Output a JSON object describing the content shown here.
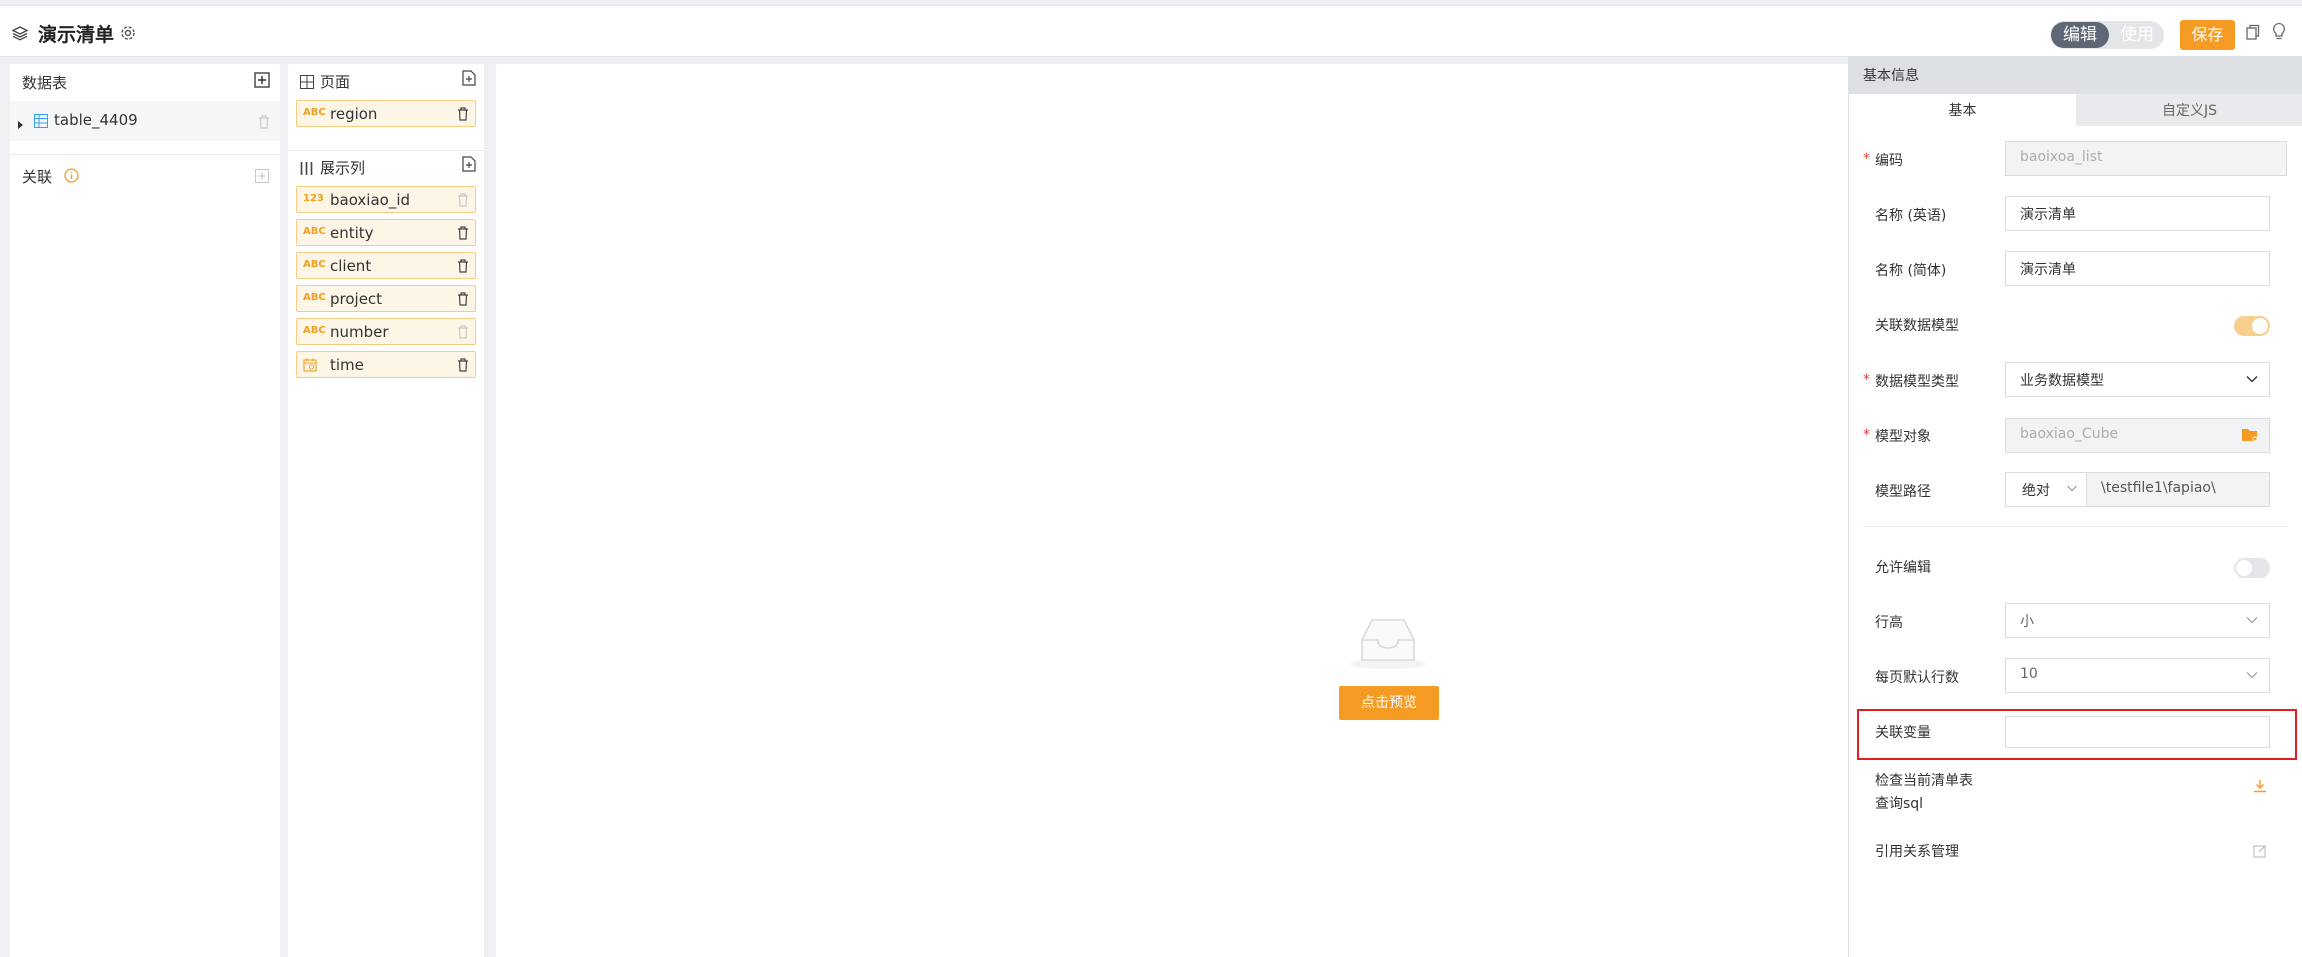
{
  "header": {
    "title": "演示清单",
    "mode_edit": "编辑",
    "mode_use": "使用",
    "save_label": "保存"
  },
  "left_panel": {
    "tables_title": "数据表",
    "table_name": "table_4409",
    "relations_title": "关联"
  },
  "fields_panel": {
    "page_title": "页面",
    "page_fields": [
      {
        "type": "ABC",
        "name": "region"
      }
    ],
    "display_title": "展示列",
    "display_fields": [
      {
        "type": "123",
        "name": "baoxiao_id"
      },
      {
        "type": "ABC",
        "name": "entity"
      },
      {
        "type": "ABC",
        "name": "client"
      },
      {
        "type": "ABC",
        "name": "project"
      },
      {
        "type": "ABC",
        "name": "number"
      },
      {
        "type": "date",
        "name": "time"
      }
    ]
  },
  "canvas": {
    "preview_button": "点击预览"
  },
  "properties": {
    "header": "基本信息",
    "tab_basic": "基本",
    "tab_custom_js": "自定义JS",
    "code_label": "编码",
    "code_value": "baoixoa_list",
    "name_en_label": "名称 (英语)",
    "name_en_value": "演示清单",
    "name_cn_label": "名称 (简体)",
    "name_cn_value": "演示清单",
    "link_model_label": "关联数据模型",
    "link_model_on": true,
    "model_type_label": "数据模型类型",
    "model_type_value": "业务数据模型",
    "model_object_label": "模型对象",
    "model_object_value": "baoxiao_Cube",
    "model_path_label": "模型路径",
    "model_path_mode": "绝对",
    "model_path_value": "\\testfile1\\fapiao\\",
    "allow_edit_label": "允许编辑",
    "allow_edit_on": false,
    "row_height_label": "行高",
    "row_height_value": "小",
    "page_rows_label": "每页默认行数",
    "page_rows_value": "10",
    "link_var_label": "关联变量",
    "link_var_value": "",
    "check_sql_label_1": "检查当前清单表",
    "check_sql_label_2": "查询sql",
    "ref_mgmt_label": "引用关系管理"
  },
  "colors": {
    "accent": "#f59a23",
    "highlight": "#e02020",
    "toggle_active": "#5d6776"
  }
}
